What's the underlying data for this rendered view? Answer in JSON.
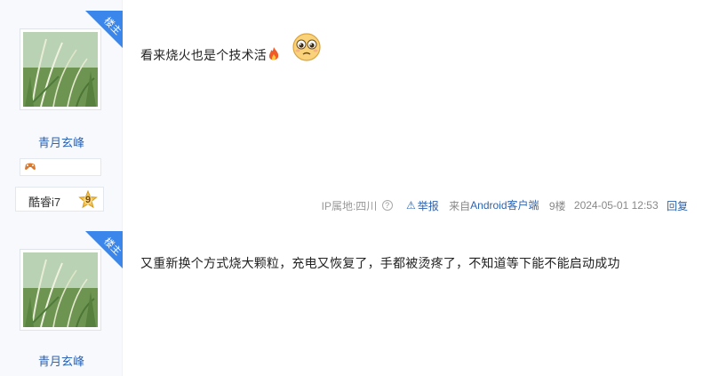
{
  "posts": [
    {
      "owner_badge": "楼主",
      "user_name": "青月玄峰",
      "level_name": "酷睿i7",
      "level_number": "9",
      "text": "看来烧火也是个技术活",
      "meta": {
        "ip_label": "IP属地:四川",
        "report_label": "举报",
        "source_prefix": "来自",
        "source_name": "Android客户端",
        "floor": "9楼",
        "timestamp": "2024-05-01 12:53",
        "reply_label": "回复"
      }
    },
    {
      "owner_badge": "楼主",
      "user_name": "青月玄峰",
      "text": "又重新换个方式烧大颗粒，充电又恢复了，手都被烫疼了，不知道等下能不能启动成功"
    }
  ],
  "colors": {
    "link_blue": "#2d64b3",
    "owner_ribbon": "#3a86ea",
    "sidebar_bg": "#f7f9fc"
  },
  "icons": {
    "fire": "fire-icon",
    "emoji": "teary-face-emoji",
    "question": "question-circle-icon",
    "report": "warning-triangle-icon",
    "mood": "gamepad-icon",
    "level": "level-star-badge"
  }
}
